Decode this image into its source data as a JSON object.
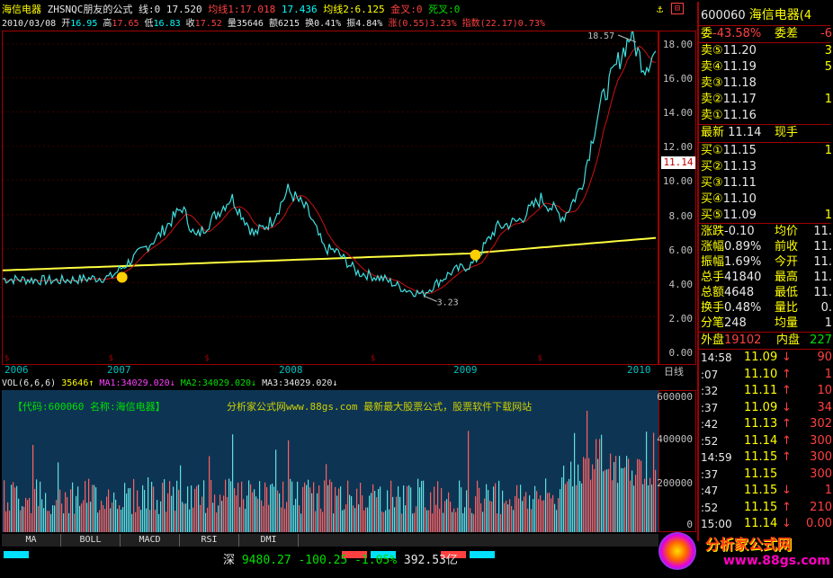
{
  "header": {
    "stock_name": "海信电器",
    "formula": "ZHSNQC朋友的公式",
    "line_label": "线:",
    "line_val": "0",
    "line2": "17.520",
    "ma1_label": "均线1:",
    "ma1_val": "17.018",
    "ma1b": "17.436",
    "ma2_label": "均线2:",
    "ma2_val": "6.125",
    "golden_label": "金叉:",
    "golden_val": "0",
    "death_label": "死叉:",
    "death_val": "0",
    "date": "2010/03/08",
    "open_label": "开",
    "open": "16.95",
    "high_label": "高",
    "high": "17.65",
    "low_label": "低",
    "low": "16.83",
    "close_label": "收",
    "close": "17.52",
    "vol_label": "量",
    "vol": "35646",
    "amt_label": "额",
    "amt": "6215",
    "turn_label": "换",
    "turn": "0.41%",
    "amp_label": "振",
    "amp": "4.84%",
    "chg_label": "涨",
    "chg": "(0.55)",
    "chg_pct": "3.23%",
    "idx_label": "指数",
    "idx": "(22.17)",
    "idx_pct": "0.73%"
  },
  "price_axis": [
    "18.00",
    "16.00",
    "14.00",
    "12.00",
    "10.00",
    "8.00",
    "6.00",
    "4.00",
    "2.00",
    "0.00"
  ],
  "current_price_tag": "11.14",
  "annotations": {
    "peak": "18.57",
    "trough": "3.23"
  },
  "time_axis": [
    "2006",
    "2007",
    "2008",
    "2009",
    "2010"
  ],
  "day_label": "日线",
  "volume": {
    "title": "VOL(6,6,6)",
    "value": "35646",
    "ma1": "MA1:34029.020",
    "ma2": "MA2:34029.020",
    "ma3": "MA3:34029.020",
    "axis": [
      "600000",
      "400000",
      "200000",
      "0"
    ],
    "code_text": "【代码:600060 名称:海信电器】",
    "site_text": "分析家公式网www.88gs.com 最新最大股票公式，股票软件下载网站"
  },
  "tabs": [
    "MA",
    "BOLL",
    "MACD",
    "RSI",
    "DMI"
  ],
  "status": {
    "market": "深",
    "index": "9480.27",
    "change": "-100.25",
    "pct": "-1.05%",
    "amount": "392.53亿"
  },
  "quote": {
    "code": "600060",
    "name": "海信电器",
    "suffix": "(4",
    "weibi_label": "委",
    "weibi": "-43.58%",
    "weicha_label": "委差",
    "weicha": "-6",
    "sells": [
      {
        "label": "卖⑤",
        "price": "11.20",
        "vol": "3"
      },
      {
        "label": "卖④",
        "price": "11.19",
        "vol": "5"
      },
      {
        "label": "卖③",
        "price": "11.18",
        "vol": ""
      },
      {
        "label": "卖②",
        "price": "11.17",
        "vol": "1"
      },
      {
        "label": "卖①",
        "price": "11.16",
        "vol": ""
      }
    ],
    "latest_label": "最新",
    "latest": "11.14",
    "hand_label": "现手",
    "buys": [
      {
        "label": "买①",
        "price": "11.15",
        "vol": "1"
      },
      {
        "label": "买②",
        "price": "11.13",
        "vol": ""
      },
      {
        "label": "买③",
        "price": "11.11",
        "vol": ""
      },
      {
        "label": "买④",
        "price": "11.10",
        "vol": ""
      },
      {
        "label": "买⑤",
        "price": "11.09",
        "vol": "1"
      }
    ],
    "stats": [
      {
        "l": "涨跌",
        "v": "-0.10",
        "l2": "均价",
        "v2": "11."
      },
      {
        "l": "涨幅",
        "v": "0.89%",
        "l2": "前收",
        "v2": "11."
      },
      {
        "l": "振幅",
        "v": "1.69%",
        "l2": "今开",
        "v2": "11."
      },
      {
        "l": "总手",
        "v": "41840",
        "l2": "最高",
        "v2": "11."
      },
      {
        "l": "总额",
        "v": "4648",
        "l2": "最低",
        "v2": "11."
      },
      {
        "l": "换手",
        "v": "0.48%",
        "l2": "量比",
        "v2": "0."
      },
      {
        "l": "分笔",
        "v": "248",
        "l2": "均量",
        "v2": "1"
      }
    ],
    "outer_label": "外盘",
    "outer": "19102",
    "inner_label": "内盘",
    "inner": "227",
    "ticks": [
      {
        "t": "14:58",
        "p": "11.09",
        "d": "↓",
        "v": "90"
      },
      {
        "t": ":07",
        "p": "11.10",
        "d": "↑",
        "v": "1"
      },
      {
        "t": ":32",
        "p": "11.11",
        "d": "↑",
        "v": "10"
      },
      {
        "t": ":37",
        "p": "11.09",
        "d": "↓",
        "v": "34"
      },
      {
        "t": ":42",
        "p": "11.13",
        "d": "↑",
        "v": "302"
      },
      {
        "t": ":52",
        "p": "11.14",
        "d": "↑",
        "v": "300"
      },
      {
        "t": "14:59",
        "p": "11.15",
        "d": "↑",
        "v": "300"
      },
      {
        "t": ":37",
        "p": "11.15",
        "d": "",
        "v": "300"
      },
      {
        "t": ":47",
        "p": "11.15",
        "d": "↓",
        "v": "1"
      },
      {
        "t": ":52",
        "p": "11.15",
        "d": "↑",
        "v": "210"
      },
      {
        "t": "15:00",
        "p": "11.14",
        "d": "↓",
        "v": "0.00"
      }
    ]
  },
  "watermark": {
    "site_cn": "分析家公式网",
    "url": "www.88gs.com"
  },
  "colors": {
    "up": "#ff4040",
    "down": "#00e000",
    "price_line": "#40e0e0",
    "ma_long": "#ffff40",
    "ma_short": "#ff2020"
  }
}
